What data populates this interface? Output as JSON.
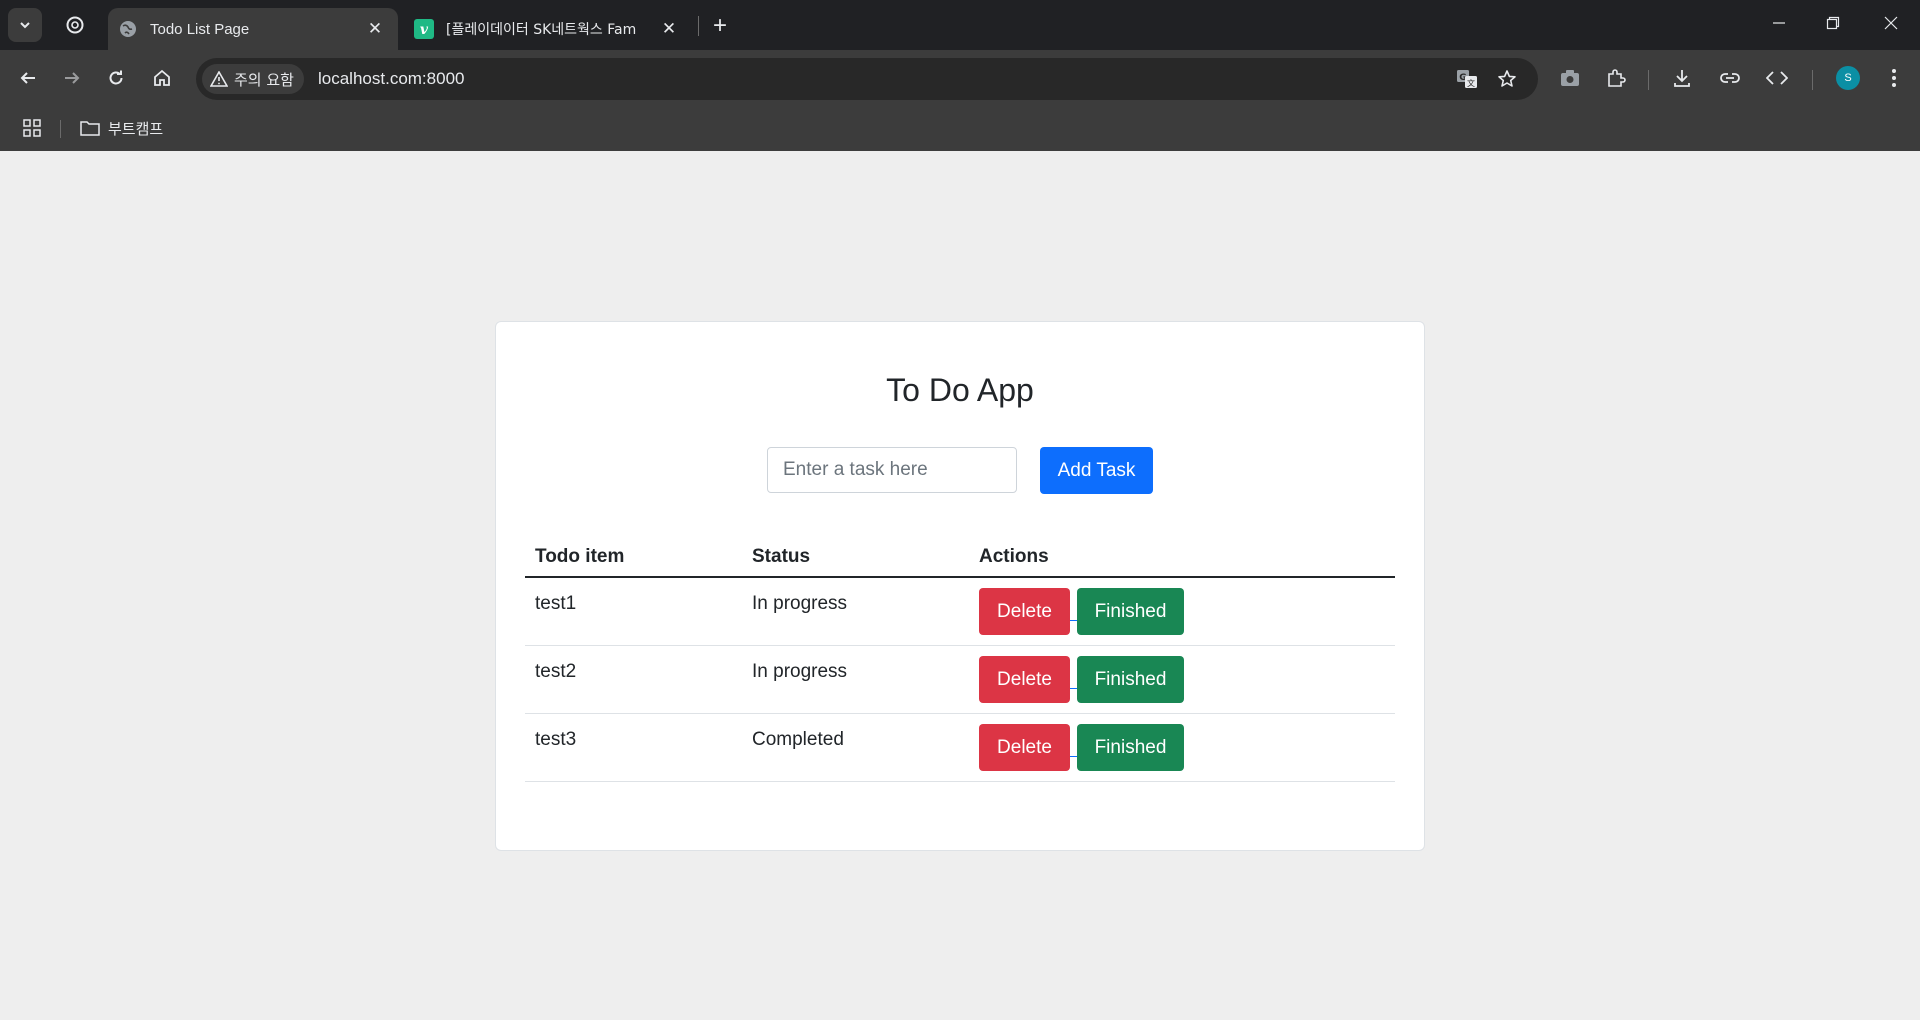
{
  "browser": {
    "tabs": [
      {
        "title": "Todo List Page",
        "active": true
      },
      {
        "title": "[플레이데이터 SK네트웍스 Fam",
        "active": false
      }
    ],
    "security_label": "주의 요함",
    "url": "localhost.com:8000",
    "profile_initial": "S",
    "bookmarks": [
      {
        "label": "부트캠프"
      }
    ],
    "icons": {
      "tab_search": "chevron-down-icon",
      "tab_favicon": "globe-icon",
      "second_tab_favicon": "v-logo-icon",
      "new_tab": "plus-icon",
      "translate": "translate-icon",
      "bookmark": "star-icon",
      "screenshot": "camera-icon",
      "extensions": "puzzle-icon",
      "download": "download-icon",
      "share_link": "link-icon",
      "devtools": "code-icon",
      "menu": "kebab-menu-icon"
    }
  },
  "app": {
    "title": "To Do App",
    "input_placeholder": "Enter a task here",
    "add_button": "Add Task",
    "columns": [
      "Todo item",
      "Status",
      "Actions"
    ],
    "rows": [
      {
        "item": "test1",
        "status": "In progress"
      },
      {
        "item": "test2",
        "status": "In progress"
      },
      {
        "item": "test3",
        "status": "Completed"
      }
    ],
    "delete_label": "Delete",
    "finished_label": "Finished"
  },
  "colors": {
    "primary": "#0d6efd",
    "danger": "#dc3545",
    "success": "#198754",
    "page_background": "#eeeeee"
  }
}
